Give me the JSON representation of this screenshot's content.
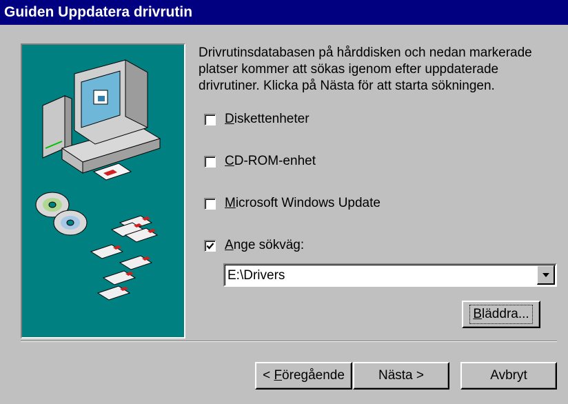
{
  "window": {
    "title": "Guiden Uppdatera drivrutin"
  },
  "main": {
    "description": "Drivrutinsdatabasen på hårddisken och nedan markerade platser kommer att sökas igenom efter uppdaterade drivrutiner. Klicka på Nästa för att starta sökningen.",
    "options": [
      {
        "label_first": "D",
        "label_rest": "iskettenheter",
        "checked": false
      },
      {
        "label_first": "C",
        "label_rest": "D-ROM-enhet",
        "checked": false
      },
      {
        "label_first": "M",
        "label_rest": "icrosoft Windows Update",
        "checked": false
      },
      {
        "label_first": "A",
        "label_rest": "nge sökväg:",
        "checked": true
      }
    ],
    "path": {
      "value": "E:\\Drivers"
    },
    "browse_button": {
      "first": "B",
      "rest": "läddra..."
    }
  },
  "footer": {
    "back": {
      "prefix": "< ",
      "first": "F",
      "rest": "öregående"
    },
    "next": {
      "label": "Nästa >"
    },
    "cancel": {
      "label": "Avbryt"
    }
  },
  "colors": {
    "title_bar": "#000080",
    "face": "#c0c0c0",
    "artwork_bg": "#008080"
  }
}
